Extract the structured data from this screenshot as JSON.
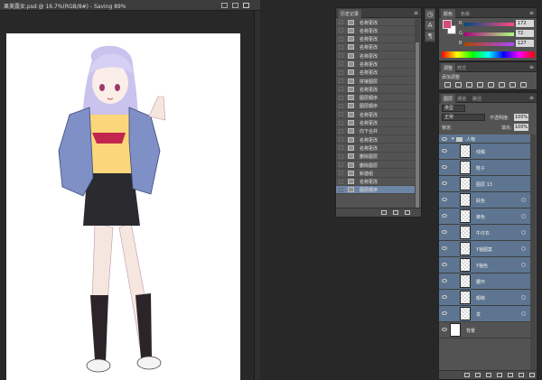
{
  "document": {
    "title": "果美露女.psd @ 16.7%(RGB/8#) - Saving 89%"
  },
  "history": {
    "tab": "历史记录",
    "items": [
      {
        "label": "名称更改"
      },
      {
        "label": "名称更改"
      },
      {
        "label": "名称更改"
      },
      {
        "label": "名称更改"
      },
      {
        "label": "名称更改"
      },
      {
        "label": "名称更改"
      },
      {
        "label": "名称更改"
      },
      {
        "label": "拼接图层"
      },
      {
        "label": "名称更改"
      },
      {
        "label": "图层顺序"
      },
      {
        "label": "图层顺序"
      },
      {
        "label": "名称更改"
      },
      {
        "label": "名称更改"
      },
      {
        "label": "向下合并"
      },
      {
        "label": "名称更改"
      },
      {
        "label": "名称更改"
      },
      {
        "label": "删除图层"
      },
      {
        "label": "删除图层"
      },
      {
        "label": "新建组"
      },
      {
        "label": "名称更改"
      },
      {
        "label": "图层顺序",
        "selected": true
      }
    ]
  },
  "color": {
    "tab": "颜色",
    "tab2": "色板",
    "foreground": "#d64a7a",
    "channels": [
      {
        "ch": "R",
        "value": "172"
      },
      {
        "ch": "G",
        "value": "72"
      },
      {
        "ch": "B",
        "value": "127"
      }
    ]
  },
  "adjustments": {
    "tab": "调整",
    "tab2": "样式",
    "add_label": "添加调整"
  },
  "layers": {
    "tab": "图层",
    "tab2": "通道",
    "tab3": "路径",
    "filter": "类型",
    "blend_mode": "正常",
    "opacity_label": "不透明度:",
    "opacity": "100%",
    "lock_label": "锁定:",
    "fill_label": "填充:",
    "fill": "100%",
    "group": "人物",
    "items": [
      {
        "name": "线稿",
        "fx": false
      },
      {
        "name": "鞋子",
        "fx": false
      },
      {
        "name": "图层 13",
        "fx": false
      },
      {
        "name": "肤色",
        "fx": true
      },
      {
        "name": "裤色",
        "fx": true
      },
      {
        "name": "牛仔衣",
        "fx": true
      },
      {
        "name": "Y袖图案",
        "fx": true
      },
      {
        "name": "Y袖色",
        "fx": true
      },
      {
        "name": "腰环",
        "fx": false
      },
      {
        "name": "眼睛",
        "fx": true
      },
      {
        "name": "发",
        "fx": true
      }
    ],
    "background": "背景"
  }
}
